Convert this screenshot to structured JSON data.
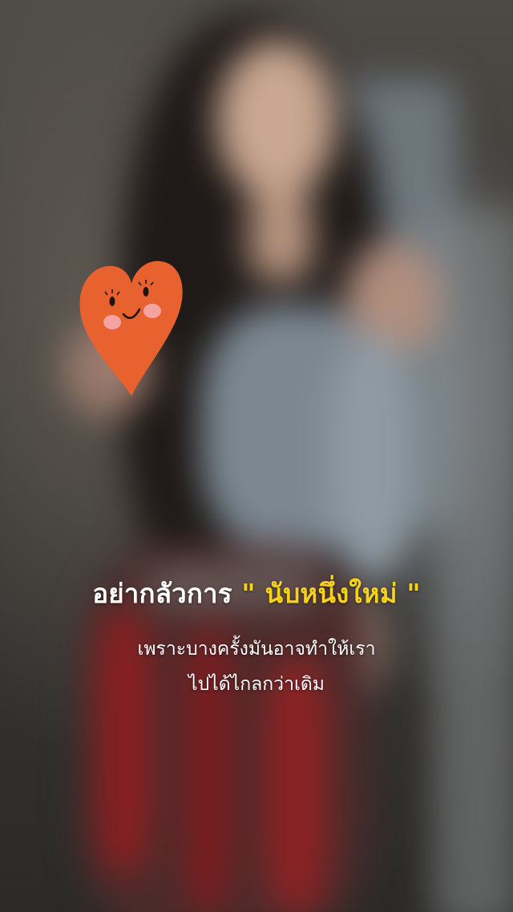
{
  "video": {
    "scene": "blurred-person",
    "sticker": "heart-face-sticker",
    "colors": {
      "heart": "#e8622f",
      "cheek": "#f4a3a0",
      "highlight_text": "#f7d21c",
      "text": "#ffffff"
    }
  },
  "caption": {
    "headline_prefix": "อย่ากลัวการ",
    "headline_highlight": "\" นับหนึ่งใหม่ \"",
    "line1": "เพราะบางครั้งมันอาจทำให้เรา",
    "line2": "ไปได้ไกลกว่าเดิม"
  }
}
